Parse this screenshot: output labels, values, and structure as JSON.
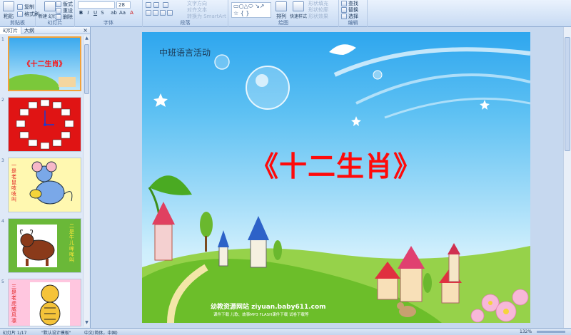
{
  "ribbon": {
    "clipboard": {
      "paste": "粘贴",
      "copy": "复制",
      "format_painter": "格式刷",
      "group": "剪贴板"
    },
    "slides": {
      "new_slide": "新建\n幻灯片",
      "layout": "版式",
      "reset": "重设",
      "delete": "删除",
      "group": "幻灯片"
    },
    "font": {
      "size": "28",
      "group": "字体"
    },
    "paragraph": {
      "text_direction": "文字方向",
      "align_text": "对齐文本",
      "smartart": "转换为 SmartArt",
      "group": "段落"
    },
    "drawing": {
      "arrange": "排列",
      "quick_styles": "快速样式",
      "shape_fill": "形状填充",
      "shape_outline": "形状轮廓",
      "shape_effects": "形状效果",
      "group": "绘图"
    },
    "editing": {
      "find": "查找",
      "replace": "替换",
      "select": "选择",
      "group": "编辑"
    }
  },
  "pane": {
    "tabs": [
      "幻灯片",
      "大纲"
    ],
    "close": "×",
    "slides": [
      {
        "num": "1",
        "title": "《十二生肖》",
        "bg": "#9fd8f6"
      },
      {
        "num": "2",
        "bg": "#e01414"
      },
      {
        "num": "3",
        "text": "一是老鼠吱吱叫",
        "bg": "#fff6a8"
      },
      {
        "num": "4",
        "text": "二是牛儿哞哞叫",
        "bg": "#6ab838"
      },
      {
        "num": "5",
        "text": "三是老虎威风凛",
        "bg": "#ffc6df"
      }
    ]
  },
  "slide": {
    "subtitle": "中班语言活动",
    "title": "《十二生肖》",
    "site": "幼教资源网站 ziyuan.baby611.com",
    "links": "课件下载    儿歌、故事MP3    FLASH课件下载    试卷下载等"
  },
  "status": {
    "slide_count": "幻灯片 1/17",
    "theme": "\"默认设计模板\"",
    "language": "中文(简体，中国)",
    "zoom": "132%"
  },
  "colors": {
    "title_red": "#ff0a0a",
    "accent_orange": "#f3a23a",
    "ribbon_blue": "#d5e4f7"
  }
}
